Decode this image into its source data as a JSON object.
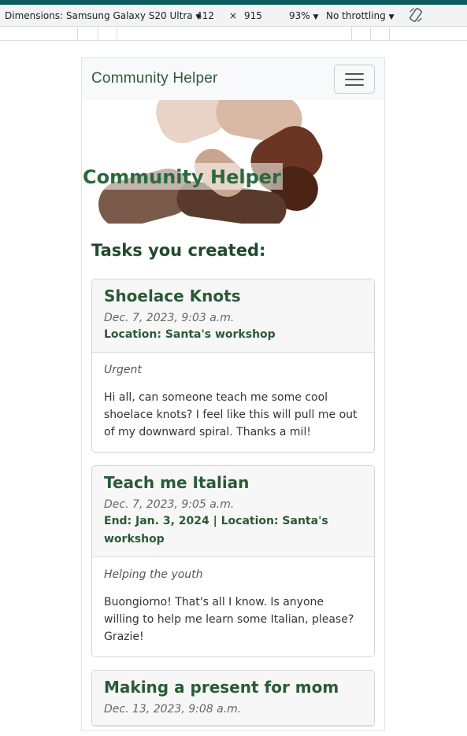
{
  "devtools": {
    "device_label": "Dimensions: Samsung Galaxy S20 Ultra",
    "width": "412",
    "times": "×",
    "height": "915",
    "zoom": "93%",
    "throttling": "No throttling",
    "dropdown_glyph": "▼",
    "rotate_icon": "rotate-icon"
  },
  "navbar": {
    "brand": "Community Helper",
    "toggler_icon": "hamburger-menu-icon"
  },
  "hero": {
    "title": "Community Helper"
  },
  "section_title": "Tasks you created:",
  "tasks": [
    {
      "title": "Shoelace Knots",
      "date": "Dec. 7, 2023, 9:03 a.m.",
      "location": "Location: Santa's workshop",
      "tag": "Urgent",
      "text": "Hi all, can someone teach me some cool shoelace knots? I feel like this will pull me out of my downward spiral. Thanks a mil!"
    },
    {
      "title": "Teach me Italian",
      "date": "Dec. 7, 2023, 9:05 a.m.",
      "location": "End: Jan. 3, 2024 | Location: Santa's workshop",
      "tag": "Helping the youth",
      "text": "Buongiorno! That's all I know. Is anyone willing to help me learn some Italian, please? Grazie!"
    },
    {
      "title": "Making a present for mom",
      "date": "Dec. 13, 2023, 9:08 a.m."
    }
  ],
  "colors": {
    "accent_green": "#2a5a36",
    "devtools_accent": "#0e5c5c"
  }
}
